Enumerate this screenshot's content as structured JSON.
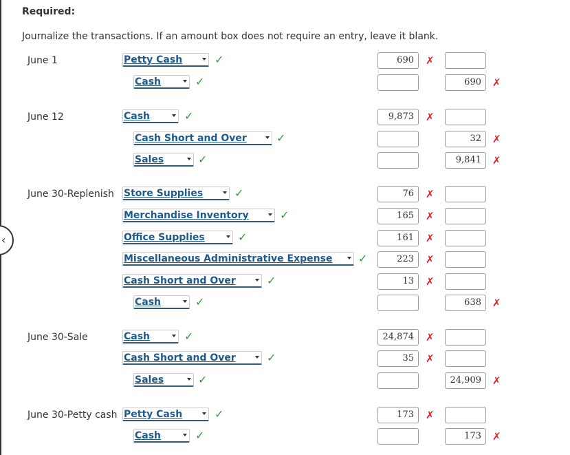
{
  "header": {
    "required_label": "Required:",
    "instructions": "Journalize the transactions. If an amount box does not require an entry, leave it blank."
  },
  "icons": {
    "check": "✓",
    "x": "✗",
    "collapse": "‹"
  },
  "colors": {
    "account_text": "#1f5a8f",
    "check": "#3a9a3a",
    "incorrect": "#d9232e"
  },
  "entries": [
    {
      "date": "June 1",
      "lines": [
        {
          "account": "Petty Cash",
          "account_status": "correct",
          "debit": "690",
          "credit": "",
          "debit_status": "incorrect",
          "credit_status": ""
        },
        {
          "account": "Cash",
          "account_status": "correct",
          "debit": "",
          "credit": "690",
          "debit_status": "",
          "credit_status": "incorrect"
        }
      ]
    },
    {
      "date": "June 12",
      "lines": [
        {
          "account": "Cash",
          "account_status": "correct",
          "debit": "9,873",
          "credit": "",
          "debit_status": "incorrect",
          "credit_status": ""
        },
        {
          "account": "Cash Short and Over",
          "account_status": "correct",
          "debit": "",
          "credit": "32",
          "debit_status": "",
          "credit_status": "incorrect"
        },
        {
          "account": "Sales",
          "account_status": "correct",
          "debit": "",
          "credit": "9,841",
          "debit_status": "",
          "credit_status": "incorrect"
        }
      ]
    },
    {
      "date": "June 30-Replenish",
      "lines": [
        {
          "account": "Store Supplies",
          "account_status": "correct",
          "debit": "76",
          "credit": "",
          "debit_status": "incorrect",
          "credit_status": ""
        },
        {
          "account": "Merchandise Inventory",
          "account_status": "correct",
          "debit": "165",
          "credit": "",
          "debit_status": "incorrect",
          "credit_status": ""
        },
        {
          "account": "Office Supplies",
          "account_status": "correct",
          "debit": "161",
          "credit": "",
          "debit_status": "incorrect",
          "credit_status": ""
        },
        {
          "account": "Miscellaneous Administrative Expense",
          "account_status": "correct",
          "debit": "223",
          "credit": "",
          "debit_status": "incorrect",
          "credit_status": ""
        },
        {
          "account": "Cash Short and Over",
          "account_status": "correct",
          "debit": "13",
          "credit": "",
          "debit_status": "incorrect",
          "credit_status": ""
        },
        {
          "account": "Cash",
          "account_status": "correct",
          "debit": "",
          "credit": "638",
          "debit_status": "",
          "credit_status": "incorrect"
        }
      ]
    },
    {
      "date": "June 30-Sale",
      "lines": [
        {
          "account": "Cash",
          "account_status": "correct",
          "debit": "24,874",
          "credit": "",
          "debit_status": "incorrect",
          "credit_status": ""
        },
        {
          "account": "Cash Short and Over",
          "account_status": "correct",
          "debit": "35",
          "credit": "",
          "debit_status": "incorrect",
          "credit_status": ""
        },
        {
          "account": "Sales",
          "account_status": "correct",
          "debit": "",
          "credit": "24,909",
          "debit_status": "",
          "credit_status": "incorrect"
        }
      ]
    },
    {
      "date": "June 30-Petty cash",
      "lines": [
        {
          "account": "Petty Cash",
          "account_status": "correct",
          "debit": "173",
          "credit": "",
          "debit_status": "incorrect",
          "credit_status": ""
        },
        {
          "account": "Cash",
          "account_status": "correct",
          "debit": "",
          "credit": "173",
          "debit_status": "",
          "credit_status": "incorrect"
        }
      ]
    }
  ]
}
